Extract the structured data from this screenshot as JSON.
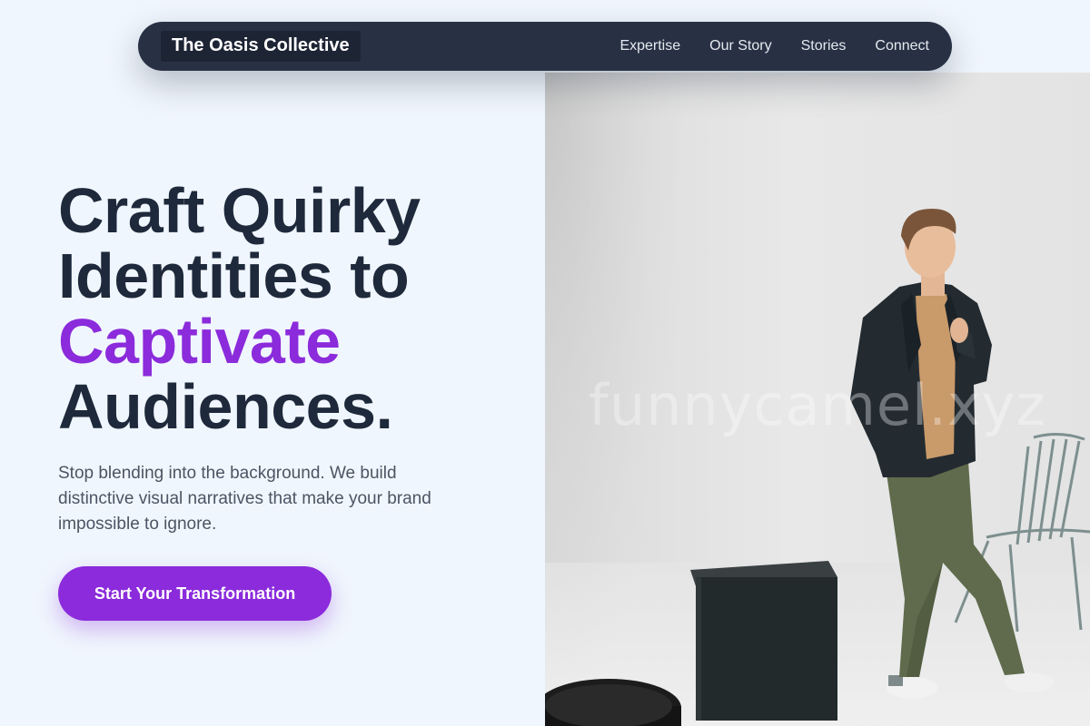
{
  "nav": {
    "brand": "The Oasis Collective",
    "links": [
      "Expertise",
      "Our Story",
      "Stories",
      "Connect"
    ]
  },
  "hero": {
    "title_line1": "Craft Quirky",
    "title_line2": "Identities to",
    "title_accent": "Captivate",
    "title_line4": "Audiences.",
    "subtitle": "Stop blending into the background. We build distinctive visual narratives that make your brand impossible to ignore.",
    "cta_label": "Start Your Transformation"
  },
  "photo": {
    "watermark": "funnycamel.xyz"
  },
  "colors": {
    "accent": "#8b2bdb",
    "navbar": "#283144",
    "heading": "#1e293b",
    "background": "#f0f6fd"
  }
}
